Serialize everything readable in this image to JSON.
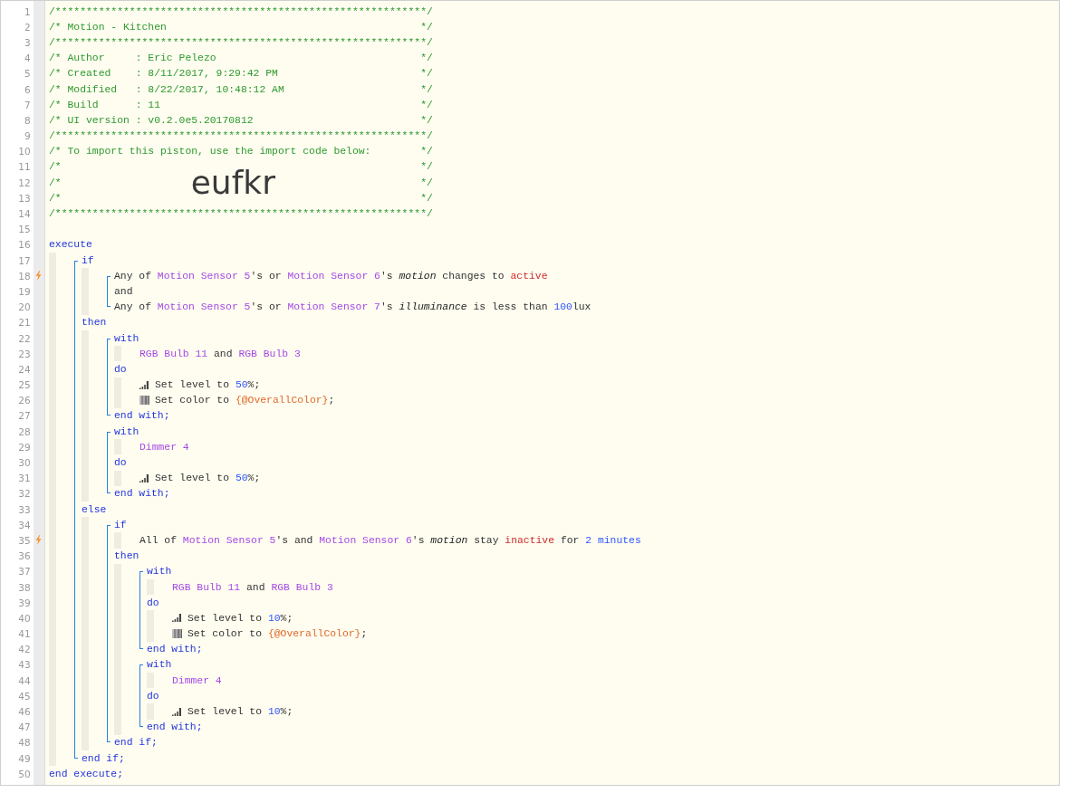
{
  "editor": {
    "lines": [
      {
        "kind": "line",
        "number": "1",
        "tokens": [
          {
            "kind": "comment",
            "text": "/************************************************************/"
          }
        ]
      },
      {
        "kind": "line",
        "number": "2",
        "tokens": [
          {
            "kind": "comment",
            "text": "/* Motion - Kitchen"
          },
          {
            "kind": "comment-end",
            "text": "*/"
          }
        ]
      },
      {
        "kind": "line",
        "number": "3",
        "tokens": [
          {
            "kind": "comment",
            "text": "/************************************************************/"
          }
        ]
      },
      {
        "kind": "line",
        "number": "4",
        "tokens": [
          {
            "kind": "comment",
            "text": "/* Author     : Eric Pelezo"
          },
          {
            "kind": "comment-end",
            "text": "*/"
          }
        ]
      },
      {
        "kind": "line",
        "number": "5",
        "tokens": [
          {
            "kind": "comment",
            "text": "/* Created    : 8/11/2017, 9:29:42 PM"
          },
          {
            "kind": "comment-end",
            "text": "*/"
          }
        ]
      },
      {
        "kind": "line",
        "number": "6",
        "tokens": [
          {
            "kind": "comment",
            "text": "/* Modified   : 8/22/2017, 10:48:12 AM"
          },
          {
            "kind": "comment-end",
            "text": "*/"
          }
        ]
      },
      {
        "kind": "line",
        "number": "7",
        "tokens": [
          {
            "kind": "comment",
            "text": "/* Build      : 11"
          },
          {
            "kind": "comment-end",
            "text": "*/"
          }
        ]
      },
      {
        "kind": "line",
        "number": "8",
        "tokens": [
          {
            "kind": "comment",
            "text": "/* UI version : v0.2.0e5.20170812"
          },
          {
            "kind": "comment-end",
            "text": "*/"
          }
        ]
      },
      {
        "kind": "line",
        "number": "9",
        "tokens": [
          {
            "kind": "comment",
            "text": "/************************************************************/"
          }
        ]
      },
      {
        "kind": "line",
        "number": "10",
        "tokens": [
          {
            "kind": "comment",
            "text": "/* To import this piston, use the import code below:"
          },
          {
            "kind": "comment-end",
            "text": "*/"
          }
        ]
      },
      {
        "kind": "line",
        "number": "11",
        "tokens": [
          {
            "kind": "comment",
            "text": "/*"
          },
          {
            "kind": "comment-end",
            "text": "*/"
          }
        ]
      },
      {
        "kind": "line",
        "number": "12",
        "tokens": [
          {
            "kind": "comment",
            "text": "/*"
          },
          {
            "kind": "import",
            "text": "eufkr"
          },
          {
            "kind": "comment-end",
            "text": "*/"
          }
        ]
      },
      {
        "kind": "line",
        "number": "13",
        "tokens": [
          {
            "kind": "comment",
            "text": "/*"
          },
          {
            "kind": "comment-end",
            "text": "*/"
          }
        ]
      },
      {
        "kind": "line",
        "number": "14",
        "tokens": [
          {
            "kind": "comment",
            "text": "/************************************************************/"
          }
        ]
      },
      {
        "kind": "line",
        "number": "15"
      },
      {
        "kind": "line",
        "number": "16",
        "tokens": [
          {
            "kind": "keyword",
            "text": "execute"
          }
        ]
      },
      {
        "kind": "indent",
        "children": [
          {
            "kind": "bracket",
            "children": [
              {
                "kind": "line",
                "number": "17",
                "tokens": [
                  {
                    "kind": "keyword",
                    "text": "if"
                  }
                ]
              },
              {
                "kind": "indent",
                "children": [
                  {
                    "kind": "bracket",
                    "children": [
                      {
                        "kind": "line",
                        "number": "18",
                        "trigger": true,
                        "tokens": [
                          {
                            "kind": "text",
                            "text": "Any of "
                          },
                          {
                            "kind": "device",
                            "text": "Motion Sensor 5"
                          },
                          {
                            "kind": "text",
                            "text": "'s or "
                          },
                          {
                            "kind": "device",
                            "text": "Motion Sensor 6"
                          },
                          {
                            "kind": "text",
                            "text": "'s "
                          },
                          {
                            "kind": "attribute",
                            "text": "motion"
                          },
                          {
                            "kind": "text",
                            "text": " changes to "
                          },
                          {
                            "kind": "value",
                            "text": "active"
                          }
                        ]
                      },
                      {
                        "kind": "line",
                        "number": "19",
                        "tokens": [
                          {
                            "kind": "text",
                            "text": "and"
                          }
                        ]
                      },
                      {
                        "kind": "line",
                        "number": "20",
                        "tokens": [
                          {
                            "kind": "text",
                            "text": "Any of "
                          },
                          {
                            "kind": "device",
                            "text": "Motion Sensor 5"
                          },
                          {
                            "kind": "text",
                            "text": "'s or "
                          },
                          {
                            "kind": "device",
                            "text": "Motion Sensor 7"
                          },
                          {
                            "kind": "text",
                            "text": "'s "
                          },
                          {
                            "kind": "attribute",
                            "text": "illuminance"
                          },
                          {
                            "kind": "text",
                            "text": " is less than "
                          },
                          {
                            "kind": "number",
                            "text": "100"
                          },
                          {
                            "kind": "text",
                            "text": "lux"
                          }
                        ]
                      }
                    ]
                  }
                ]
              },
              {
                "kind": "line",
                "number": "21",
                "tokens": [
                  {
                    "kind": "keyword",
                    "text": "then"
                  }
                ]
              },
              {
                "kind": "indent",
                "children": [
                  {
                    "kind": "bracket",
                    "children": [
                      {
                        "kind": "line",
                        "number": "22",
                        "tokens": [
                          {
                            "kind": "keyword",
                            "text": "with"
                          }
                        ]
                      },
                      {
                        "kind": "indent",
                        "children": [
                          {
                            "kind": "line",
                            "number": "23",
                            "tokens": [
                              {
                                "kind": "device",
                                "text": "RGB Bulb 11"
                              },
                              {
                                "kind": "text",
                                "text": " and "
                              },
                              {
                                "kind": "device",
                                "text": "RGB Bulb 3"
                              }
                            ]
                          }
                        ]
                      },
                      {
                        "kind": "line",
                        "number": "24",
                        "tokens": [
                          {
                            "kind": "keyword",
                            "text": "do"
                          }
                        ]
                      },
                      {
                        "kind": "indent",
                        "children": [
                          {
                            "kind": "level",
                            "number": "25",
                            "tokens": [
                              {
                                "kind": "text",
                                "text": "Set level to "
                              },
                              {
                                "kind": "number",
                                "text": "50"
                              },
                              {
                                "kind": "text",
                                "text": "%;"
                              }
                            ]
                          },
                          {
                            "kind": "color",
                            "number": "26",
                            "tokens": [
                              {
                                "kind": "text",
                                "text": "Set color to "
                              },
                              {
                                "kind": "variable",
                                "text": "{@OverallColor}"
                              },
                              {
                                "kind": "text",
                                "text": ";"
                              }
                            ]
                          }
                        ]
                      },
                      {
                        "kind": "line",
                        "number": "27",
                        "tokens": [
                          {
                            "kind": "keyword",
                            "text": "end with;"
                          }
                        ]
                      }
                    ]
                  },
                  {
                    "kind": "bracket",
                    "children": [
                      {
                        "kind": "line",
                        "number": "28",
                        "tokens": [
                          {
                            "kind": "keyword",
                            "text": "with"
                          }
                        ]
                      },
                      {
                        "kind": "indent",
                        "children": [
                          {
                            "kind": "line",
                            "number": "29",
                            "tokens": [
                              {
                                "kind": "device",
                                "text": "Dimmer 4"
                              }
                            ]
                          }
                        ]
                      },
                      {
                        "kind": "line",
                        "number": "30",
                        "tokens": [
                          {
                            "kind": "keyword",
                            "text": "do"
                          }
                        ]
                      },
                      {
                        "kind": "indent",
                        "children": [
                          {
                            "kind": "level",
                            "number": "31",
                            "tokens": [
                              {
                                "kind": "text",
                                "text": "Set level to "
                              },
                              {
                                "kind": "number",
                                "text": "50"
                              },
                              {
                                "kind": "text",
                                "text": "%;"
                              }
                            ]
                          }
                        ]
                      },
                      {
                        "kind": "line",
                        "number": "32",
                        "tokens": [
                          {
                            "kind": "keyword",
                            "text": "end with;"
                          }
                        ]
                      }
                    ]
                  }
                ]
              },
              {
                "kind": "line",
                "number": "33",
                "tokens": [
                  {
                    "kind": "keyword",
                    "text": "else"
                  }
                ]
              },
              {
                "kind": "indent",
                "children": [
                  {
                    "kind": "bracket",
                    "children": [
                      {
                        "kind": "line",
                        "number": "34",
                        "tokens": [
                          {
                            "kind": "keyword",
                            "text": "if"
                          }
                        ]
                      },
                      {
                        "kind": "indent",
                        "children": [
                          {
                            "kind": "line",
                            "number": "35",
                            "trigger": true,
                            "tokens": [
                              {
                                "kind": "text",
                                "text": "All of "
                              },
                              {
                                "kind": "device",
                                "text": "Motion Sensor 5"
                              },
                              {
                                "kind": "text",
                                "text": "'s and "
                              },
                              {
                                "kind": "device",
                                "text": "Motion Sensor 6"
                              },
                              {
                                "kind": "text",
                                "text": "'s "
                              },
                              {
                                "kind": "attribute",
                                "text": "motion"
                              },
                              {
                                "kind": "text",
                                "text": " stay "
                              },
                              {
                                "kind": "value",
                                "text": "inactive"
                              },
                              {
                                "kind": "text",
                                "text": " for "
                              },
                              {
                                "kind": "number",
                                "text": "2 minutes"
                              }
                            ]
                          }
                        ]
                      },
                      {
                        "kind": "line",
                        "number": "36",
                        "tokens": [
                          {
                            "kind": "keyword",
                            "text": "then"
                          }
                        ]
                      },
                      {
                        "kind": "indent",
                        "children": [
                          {
                            "kind": "bracket",
                            "children": [
                              {
                                "kind": "line",
                                "number": "37",
                                "tokens": [
                                  {
                                    "kind": "keyword",
                                    "text": "with"
                                  }
                                ]
                              },
                              {
                                "kind": "indent",
                                "children": [
                                  {
                                    "kind": "line",
                                    "number": "38",
                                    "tokens": [
                                      {
                                        "kind": "device",
                                        "text": "RGB Bulb 11"
                                      },
                                      {
                                        "kind": "text",
                                        "text": " and "
                                      },
                                      {
                                        "kind": "device",
                                        "text": "RGB Bulb 3"
                                      }
                                    ]
                                  }
                                ]
                              },
                              {
                                "kind": "line",
                                "number": "39",
                                "tokens": [
                                  {
                                    "kind": "keyword",
                                    "text": "do"
                                  }
                                ]
                              },
                              {
                                "kind": "indent",
                                "children": [
                                  {
                                    "kind": "level",
                                    "number": "40",
                                    "tokens": [
                                      {
                                        "kind": "text",
                                        "text": "Set level to "
                                      },
                                      {
                                        "kind": "number",
                                        "text": "10"
                                      },
                                      {
                                        "kind": "text",
                                        "text": "%;"
                                      }
                                    ]
                                  },
                                  {
                                    "kind": "color",
                                    "number": "41",
                                    "tokens": [
                                      {
                                        "kind": "text",
                                        "text": "Set color to "
                                      },
                                      {
                                        "kind": "variable",
                                        "text": "{@OverallColor}"
                                      },
                                      {
                                        "kind": "text",
                                        "text": ";"
                                      }
                                    ]
                                  }
                                ]
                              },
                              {
                                "kind": "line",
                                "number": "42",
                                "tokens": [
                                  {
                                    "kind": "keyword",
                                    "text": "end with;"
                                  }
                                ]
                              }
                            ]
                          },
                          {
                            "kind": "bracket",
                            "children": [
                              {
                                "kind": "line",
                                "number": "43",
                                "tokens": [
                                  {
                                    "kind": "keyword",
                                    "text": "with"
                                  }
                                ]
                              },
                              {
                                "kind": "indent",
                                "children": [
                                  {
                                    "kind": "line",
                                    "number": "44",
                                    "tokens": [
                                      {
                                        "kind": "device",
                                        "text": "Dimmer 4"
                                      }
                                    ]
                                  }
                                ]
                              },
                              {
                                "kind": "line",
                                "number": "45",
                                "tokens": [
                                  {
                                    "kind": "keyword",
                                    "text": "do"
                                  }
                                ]
                              },
                              {
                                "kind": "indent",
                                "children": [
                                  {
                                    "kind": "level",
                                    "number": "46",
                                    "tokens": [
                                      {
                                        "kind": "text",
                                        "text": "Set level to "
                                      },
                                      {
                                        "kind": "number",
                                        "text": "10"
                                      },
                                      {
                                        "kind": "text",
                                        "text": "%;"
                                      }
                                    ]
                                  }
                                ]
                              },
                              {
                                "kind": "line",
                                "number": "47",
                                "tokens": [
                                  {
                                    "kind": "keyword",
                                    "text": "end with;"
                                  }
                                ]
                              }
                            ]
                          }
                        ]
                      },
                      {
                        "kind": "line",
                        "number": "48",
                        "tokens": [
                          {
                            "kind": "keyword",
                            "text": "end if;"
                          }
                        ]
                      }
                    ]
                  }
                ]
              },
              {
                "kind": "line",
                "number": "49",
                "tokens": [
                  {
                    "kind": "keyword",
                    "text": "end if;"
                  }
                ]
              }
            ]
          }
        ]
      },
      {
        "kind": "line",
        "number": "50",
        "tokens": [
          {
            "kind": "keyword",
            "text": "end execute;"
          }
        ]
      }
    ]
  }
}
